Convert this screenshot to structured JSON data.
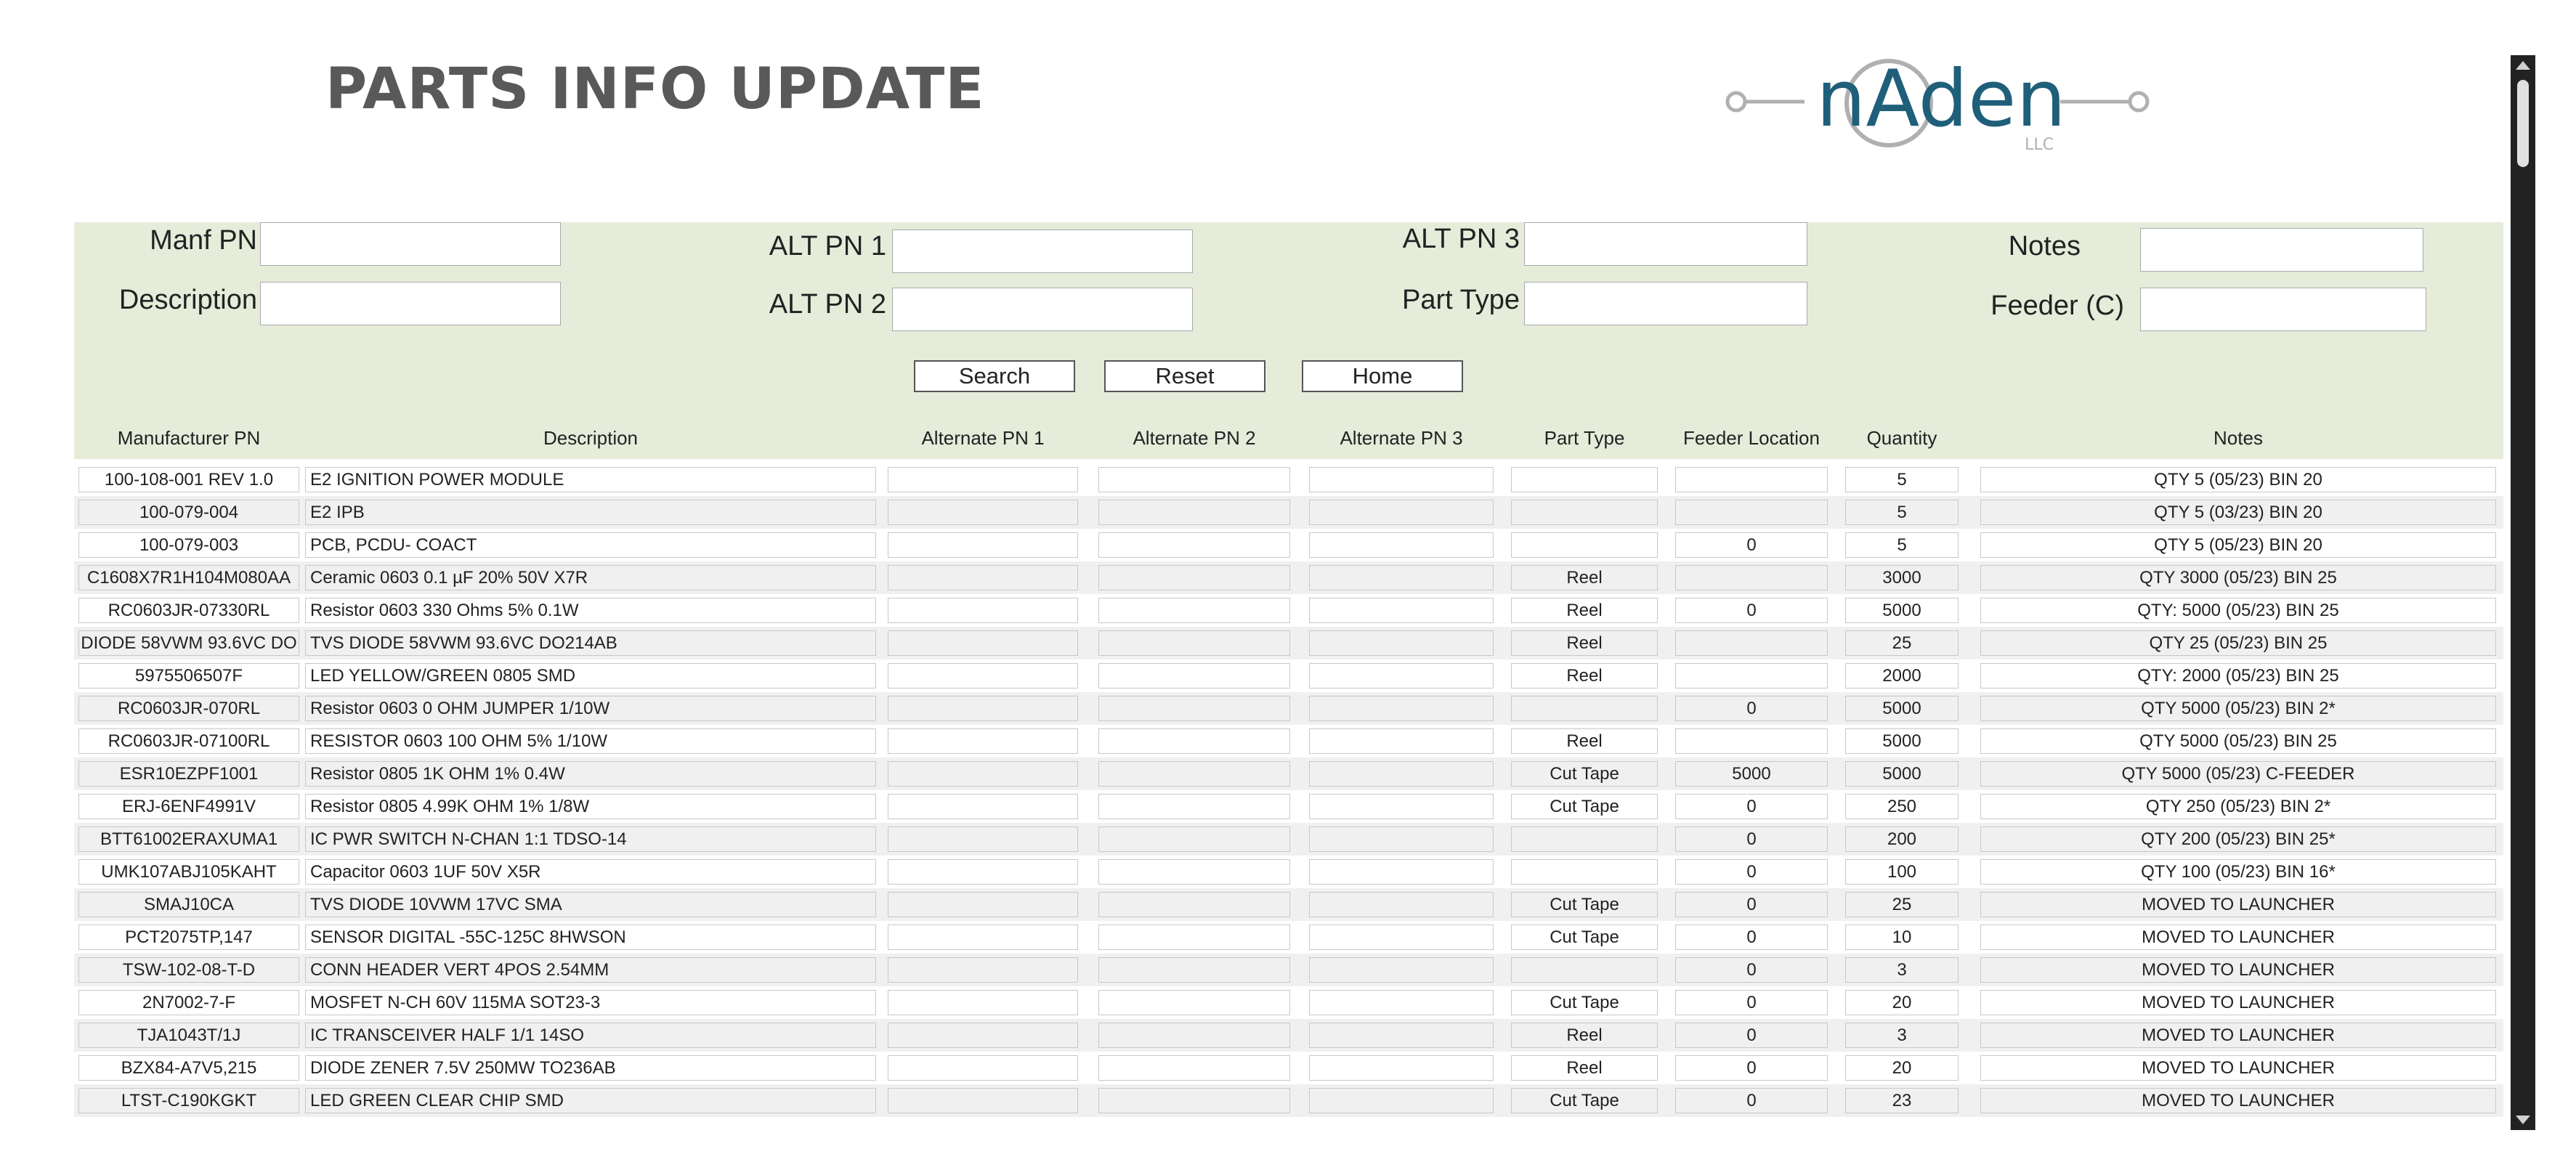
{
  "header": {
    "title": "PARTS INFO UPDATE",
    "logo_text": "nAden",
    "logo_subtext": "LLC"
  },
  "search": {
    "manf_pn_label": "Manf PN",
    "description_label": "Description",
    "alt_pn1_label": "ALT PN 1",
    "alt_pn2_label": "ALT PN 2",
    "alt_pn3_label": "ALT PN 3",
    "part_type_label": "Part Type",
    "notes_label": "Notes",
    "feeder_label": "Feeder (C)",
    "manf_pn_value": "",
    "description_value": "",
    "alt_pn1_value": "",
    "alt_pn2_value": "",
    "alt_pn3_value": "",
    "part_type_value": "",
    "notes_value": "",
    "feeder_value": "",
    "search_button": "Search",
    "reset_button": "Reset",
    "home_button": "Home"
  },
  "table": {
    "columns": [
      "Manufacturer PN",
      "Description",
      "Alternate PN 1",
      "Alternate PN 2",
      "Alternate PN 3",
      "Part Type",
      "Feeder Location",
      "Quantity",
      "Notes"
    ],
    "rows": [
      {
        "mpn": "100-108-001 REV 1.0",
        "desc": "E2 IGNITION POWER MODULE",
        "alt1": "",
        "alt2": "",
        "alt3": "",
        "type": "",
        "feeder": "",
        "qty": "5",
        "notes": "QTY 5 (05/23) BIN 20"
      },
      {
        "mpn": "100-079-004",
        "desc": "E2 IPB",
        "alt1": "",
        "alt2": "",
        "alt3": "",
        "type": "",
        "feeder": "",
        "qty": "5",
        "notes": "QTY 5 (03/23) BIN 20"
      },
      {
        "mpn": "100-079-003",
        "desc": "PCB, PCDU- COACT",
        "alt1": "",
        "alt2": "",
        "alt3": "",
        "type": "",
        "feeder": "0",
        "qty": "5",
        "notes": "QTY 5 (05/23) BIN 20"
      },
      {
        "mpn": "C1608X7R1H104M080AA",
        "desc": "Ceramic 0603 0.1 µF 20% 50V X7R",
        "alt1": "",
        "alt2": "",
        "alt3": "",
        "type": "Reel",
        "feeder": "",
        "qty": "3000",
        "notes": "QTY 3000 (05/23) BIN 25"
      },
      {
        "mpn": "RC0603JR-07330RL",
        "desc": "Resistor 0603 330 Ohms 5% 0.1W",
        "alt1": "",
        "alt2": "",
        "alt3": "",
        "type": "Reel",
        "feeder": "0",
        "qty": "5000",
        "notes": "QTY: 5000 (05/23) BIN 25"
      },
      {
        "mpn": "DIODE 58VWM 93.6VC DO",
        "desc": "TVS DIODE 58VWM 93.6VC DO214AB",
        "alt1": "",
        "alt2": "",
        "alt3": "",
        "type": "Reel",
        "feeder": "",
        "qty": "25",
        "notes": "QTY 25 (05/23) BIN 25"
      },
      {
        "mpn": "5975506507F",
        "desc": "LED YELLOW/GREEN 0805 SMD",
        "alt1": "",
        "alt2": "",
        "alt3": "",
        "type": "Reel",
        "feeder": "",
        "qty": "2000",
        "notes": "QTY: 2000 (05/23) BIN 25"
      },
      {
        "mpn": "RC0603JR-070RL",
        "desc": "Resistor 0603 0 OHM JUMPER 1/10W",
        "alt1": "",
        "alt2": "",
        "alt3": "",
        "type": "",
        "feeder": "0",
        "qty": "5000",
        "notes": "QTY 5000 (05/23) BIN 2*"
      },
      {
        "mpn": "RC0603JR-07100RL",
        "desc": "RESISTOR 0603 100 OHM 5% 1/10W",
        "alt1": "",
        "alt2": "",
        "alt3": "",
        "type": "Reel",
        "feeder": "",
        "qty": "5000",
        "notes": "QTY 5000 (05/23) BIN 25"
      },
      {
        "mpn": "ESR10EZPF1001",
        "desc": "Resistor  0805 1K OHM 1% 0.4W",
        "alt1": "",
        "alt2": "",
        "alt3": "",
        "type": "Cut Tape",
        "feeder": "5000",
        "qty": "5000",
        "notes": "QTY 5000 (05/23) C-FEEDER"
      },
      {
        "mpn": "ERJ-6ENF4991V",
        "desc": "Resistor 0805 4.99K OHM 1% 1/8W",
        "alt1": "",
        "alt2": "",
        "alt3": "",
        "type": "Cut Tape",
        "feeder": "0",
        "qty": "250",
        "notes": "QTY 250 (05/23) BIN 2*"
      },
      {
        "mpn": "BTT61002ERAXUMA1",
        "desc": "IC PWR SWITCH N-CHAN 1:1 TDSO-14",
        "alt1": "",
        "alt2": "",
        "alt3": "",
        "type": "",
        "feeder": "0",
        "qty": "200",
        "notes": "QTY 200 (05/23) BIN 25*"
      },
      {
        "mpn": "UMK107ABJ105KAHT",
        "desc": "Capacitor 0603 1UF 50V X5R",
        "alt1": "",
        "alt2": "",
        "alt3": "",
        "type": "",
        "feeder": "0",
        "qty": "100",
        "notes": "QTY 100 (05/23) BIN 16*"
      },
      {
        "mpn": "SMAJ10CA",
        "desc": "TVS DIODE 10VWM 17VC SMA",
        "alt1": "",
        "alt2": "",
        "alt3": "",
        "type": "Cut Tape",
        "feeder": "0",
        "qty": "25",
        "notes": "MOVED TO LAUNCHER"
      },
      {
        "mpn": "PCT2075TP,147",
        "desc": "SENSOR DIGITAL -55C-125C 8HWSON",
        "alt1": "",
        "alt2": "",
        "alt3": "",
        "type": "Cut Tape",
        "feeder": "0",
        "qty": "10",
        "notes": "MOVED TO LAUNCHER"
      },
      {
        "mpn": "TSW-102-08-T-D",
        "desc": "CONN HEADER VERT 4POS 2.54MM",
        "alt1": "",
        "alt2": "",
        "alt3": "",
        "type": "",
        "feeder": "0",
        "qty": "3",
        "notes": "MOVED TO LAUNCHER"
      },
      {
        "mpn": "2N7002-7-F",
        "desc": "MOSFET N-CH 60V 115MA SOT23-3",
        "alt1": "",
        "alt2": "",
        "alt3": "",
        "type": "Cut Tape",
        "feeder": "0",
        "qty": "20",
        "notes": "MOVED TO LAUNCHER"
      },
      {
        "mpn": "TJA1043T/1J",
        "desc": "IC TRANSCEIVER HALF 1/1 14SO",
        "alt1": "",
        "alt2": "",
        "alt3": "",
        "type": "Reel",
        "feeder": "0",
        "qty": "3",
        "notes": "MOVED TO LAUNCHER"
      },
      {
        "mpn": "BZX84-A7V5,215",
        "desc": "DIODE ZENER 7.5V 250MW TO236AB",
        "alt1": "",
        "alt2": "",
        "alt3": "",
        "type": "Reel",
        "feeder": "0",
        "qty": "20",
        "notes": "MOVED TO LAUNCHER"
      },
      {
        "mpn": "LTST-C190KGKT",
        "desc": "LED GREEN CLEAR CHIP SMD",
        "alt1": "",
        "alt2": "",
        "alt3": "",
        "type": "Cut Tape",
        "feeder": "0",
        "qty": "23",
        "notes": "MOVED TO LAUNCHER"
      }
    ]
  },
  "colors": {
    "panel_bg": "#e5ecda",
    "title": "#595959",
    "logo": "#1f5f7a",
    "logo_gray": "#b0b0b0"
  }
}
